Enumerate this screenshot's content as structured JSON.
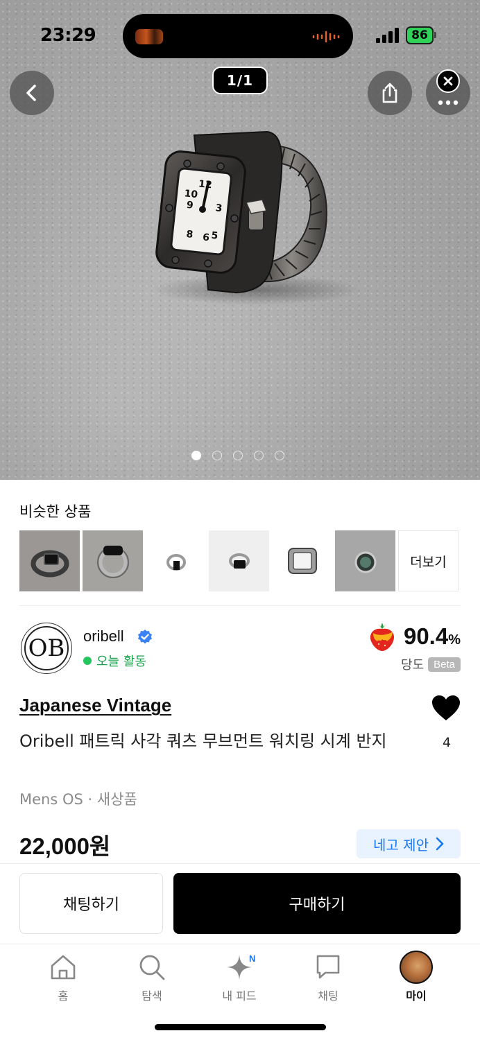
{
  "status_bar": {
    "time": "23:29",
    "battery": "86"
  },
  "hero": {
    "image_counter": "1/1",
    "back_icon": "chevron-left-icon",
    "share_icon": "share-icon",
    "more_icon": "more-icon",
    "close_icon": "close-icon",
    "pager_count": 5,
    "pager_active": 0
  },
  "similar": {
    "title": "비슷한 상품",
    "more_label": "더보기"
  },
  "seller": {
    "avatar_text": "OB",
    "name": "oribell",
    "activity": "오늘 활동",
    "score": "90.4",
    "score_unit": "%",
    "score_label": "당도",
    "beta": "Beta"
  },
  "product": {
    "brand": "Japanese Vintage",
    "title": "Oribell 패트릭 사각 쿼츠 무브먼트 워치링 시계 반지",
    "meta": "Mens OS · 새상품",
    "price": "22,000원",
    "likes": "4",
    "offer_label": "네고 제안"
  },
  "actions": {
    "chat": "채팅하기",
    "buy": "구매하기"
  },
  "tabs": {
    "home": "홈",
    "search": "탐색",
    "feed": "내 피드",
    "feed_badge": "N",
    "chat": "채팅",
    "my": "마이"
  },
  "colors": {
    "accent_blue": "#1877f2",
    "active_green": "#22c55e",
    "buy_button": "#000000"
  }
}
